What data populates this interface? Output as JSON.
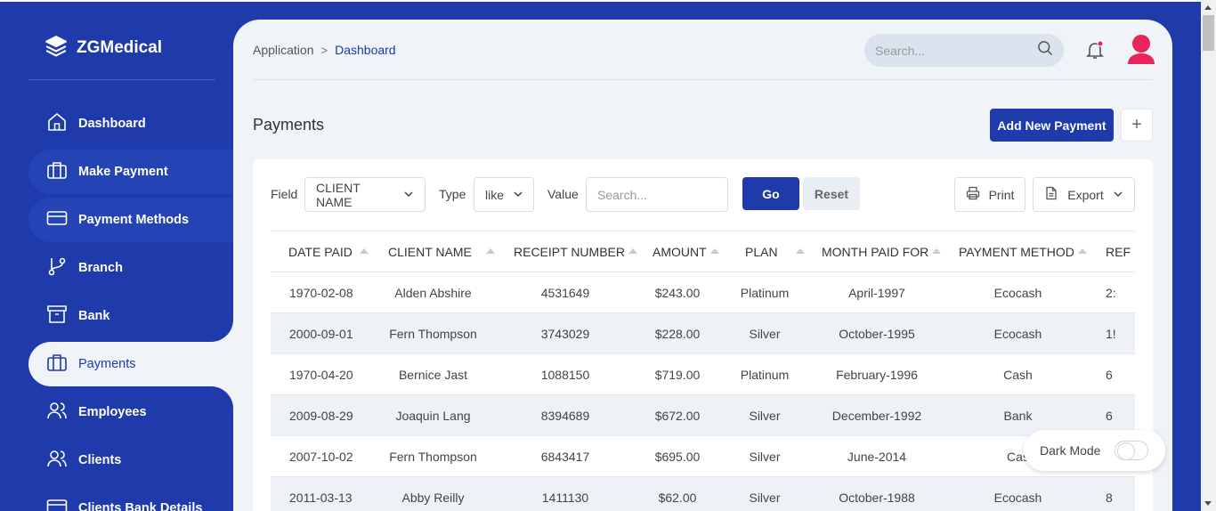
{
  "brand": {
    "name": "ZGMedical",
    "icon": "layers-icon"
  },
  "sidebar": {
    "items": [
      {
        "label": "Dashboard",
        "icon": "home-icon"
      },
      {
        "label": "Make Payment",
        "icon": "briefcase-icon"
      },
      {
        "label": "Payment Methods",
        "icon": "credit-card-icon"
      },
      {
        "label": "Branch",
        "icon": "git-branch-icon"
      },
      {
        "label": "Bank",
        "icon": "archive-icon"
      },
      {
        "label": "Payments",
        "icon": "briefcase-icon"
      },
      {
        "label": "Employees",
        "icon": "users-icon"
      },
      {
        "label": "Clients",
        "icon": "users-icon"
      },
      {
        "label": "Clients Bank Details",
        "icon": "credit-card-icon"
      }
    ]
  },
  "breadcrumb": {
    "root": "Application",
    "separator": ">",
    "current": "Dashboard"
  },
  "search": {
    "placeholder": "Search...",
    "value": ""
  },
  "page": {
    "title": "Payments",
    "add_label": "Add New Payment",
    "plus_label": "+"
  },
  "filters": {
    "field_label": "Field",
    "field_value": "CLIENT NAME",
    "type_label": "Type",
    "type_value": "like",
    "value_label": "Value",
    "value_placeholder": "Search...",
    "go_label": "Go",
    "reset_label": "Reset",
    "print_label": "Print",
    "export_label": "Export"
  },
  "table": {
    "columns": [
      "DATE PAID",
      "CLIENT NAME",
      "RECEIPT NUMBER",
      "AMOUNT",
      "PLAN",
      "MONTH PAID FOR",
      "PAYMENT METHOD",
      "REF"
    ],
    "rows": [
      [
        "1970-02-08",
        "Alden Abshire",
        "4531649",
        "$243.00",
        "Platinum",
        "April-1997",
        "Ecocash",
        "2:"
      ],
      [
        "2000-09-01",
        "Fern Thompson",
        "3743029",
        "$228.00",
        "Silver",
        "October-1995",
        "Ecocash",
        "1!"
      ],
      [
        "1970-04-20",
        "Bernice Jast",
        "1088150",
        "$719.00",
        "Platinum",
        "February-1996",
        "Cash",
        "6"
      ],
      [
        "2009-08-29",
        "Joaquin Lang",
        "8394689",
        "$672.00",
        "Silver",
        "December-1992",
        "Bank",
        "6"
      ],
      [
        "2007-10-02",
        "Fern Thompson",
        "6843417",
        "$695.00",
        "Silver",
        "June-2014",
        "Cas",
        ""
      ],
      [
        "2011-03-13",
        "Abby Reilly",
        "1411130",
        "$62.00",
        "Silver",
        "October-1988",
        "Ecocash",
        "8"
      ]
    ]
  },
  "dark_mode": {
    "label": "Dark Mode",
    "enabled": false
  },
  "colors": {
    "primary": "#1e3aab",
    "background": "#f0f3f7",
    "avatar": "#e8255b",
    "notification_dot": "#e8255b"
  }
}
